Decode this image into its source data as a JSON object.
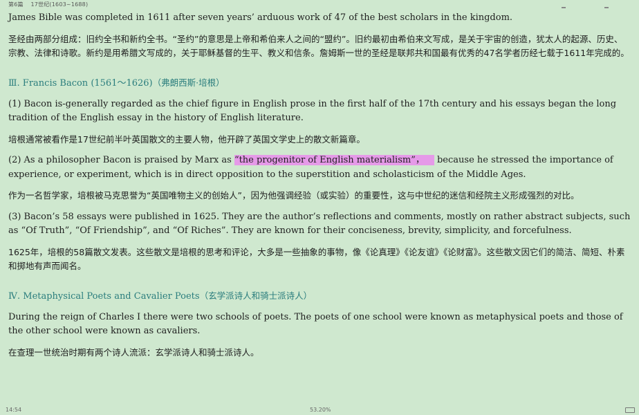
{
  "header": {
    "chapter": "第6篇",
    "section": "17世纪(1603~1688)"
  },
  "content": {
    "p0_en": "James Bible was completed in 1611 after seven years’ arduous work of 47 of the best scholars in the kingdom.",
    "p0_zh": "圣经由两部分组成：旧约全书和新约全书。“圣约”的意思是上帝和希伯来人之间的“盟约”。旧约最初由希伯来文写成，是关于宇宙的创造，犹太人的起源、历史、宗教、法律和诗歌。新约是用希腊文写成的，关于耶稣基督的生平、教义和信条。詹姆斯一世的圣经是联邦共和国最有优秀的47名学者历经七载于1611年完成的。",
    "h3_en": "Ⅲ. Francis Bacon (1561～1626)",
    "h3_zh": "（弗朗西斯·培根）",
    "p1_en": "(1) Bacon is-generally regarded as the chief figure in English prose in the first half of the 17th century and his essays began the long tradition of the English essay in the history of English literature.",
    "p1_zh": "培根通常被看作是17世纪前半叶英国散文的主要人物，他开辟了英国文学史上的散文新篇章。",
    "p2_en_a": "(2) As a philosopher Bacon is praised by Marx as ",
    "p2_en_hl": "“the progenitor of English materialism”，",
    "p2_en_b": " because he stressed the importance of experience, or experiment, which is in direct opposition to the superstition and scholasticism of the Middle Ages.",
    "p2_zh": "作为一名哲学家，培根被马克思誉为“英国唯物主义的创始人”，因为他强调经验（或实验）的重要性，这与中世纪的迷信和经院主义形成强烈的对比。",
    "p3_en": "(3) Bacon’s 58 essays were published in 1625. They are the author’s reflections and comments, mostly on rather abstract subjects, such as “Of Truth”, “Of Friendship”, and “Of Riches”. They are known for their conciseness, brevity, simplicity, and forcefulness.",
    "p3_zh": "1625年，培根的58篇散文发表。这些散文是培根的思考和评论，大多是一些抽象的事物，像《论真理》《论友谊》《论财富》。这些散文因它们的简洁、简短、朴素和掷地有声而闻名。",
    "h4_en": "Ⅳ. Metaphysical Poets and Cavalier Poets",
    "h4_zh": "（玄学派诗人和骑士派诗人）",
    "p4_en": "During the reign of Charles I there were two schools of poets. The poets of one school were known as metaphysical poets and those of the other school were known as cavaliers.",
    "p4_zh": "在查理一世统治时期有两个诗人流派：玄学派诗人和骑士派诗人。"
  },
  "footer": {
    "time": "14:54",
    "progress": "53.20%"
  },
  "colors": {
    "background": "#cfe8cf",
    "heading": "#2a7d7d",
    "highlight": "#e59ae8"
  }
}
